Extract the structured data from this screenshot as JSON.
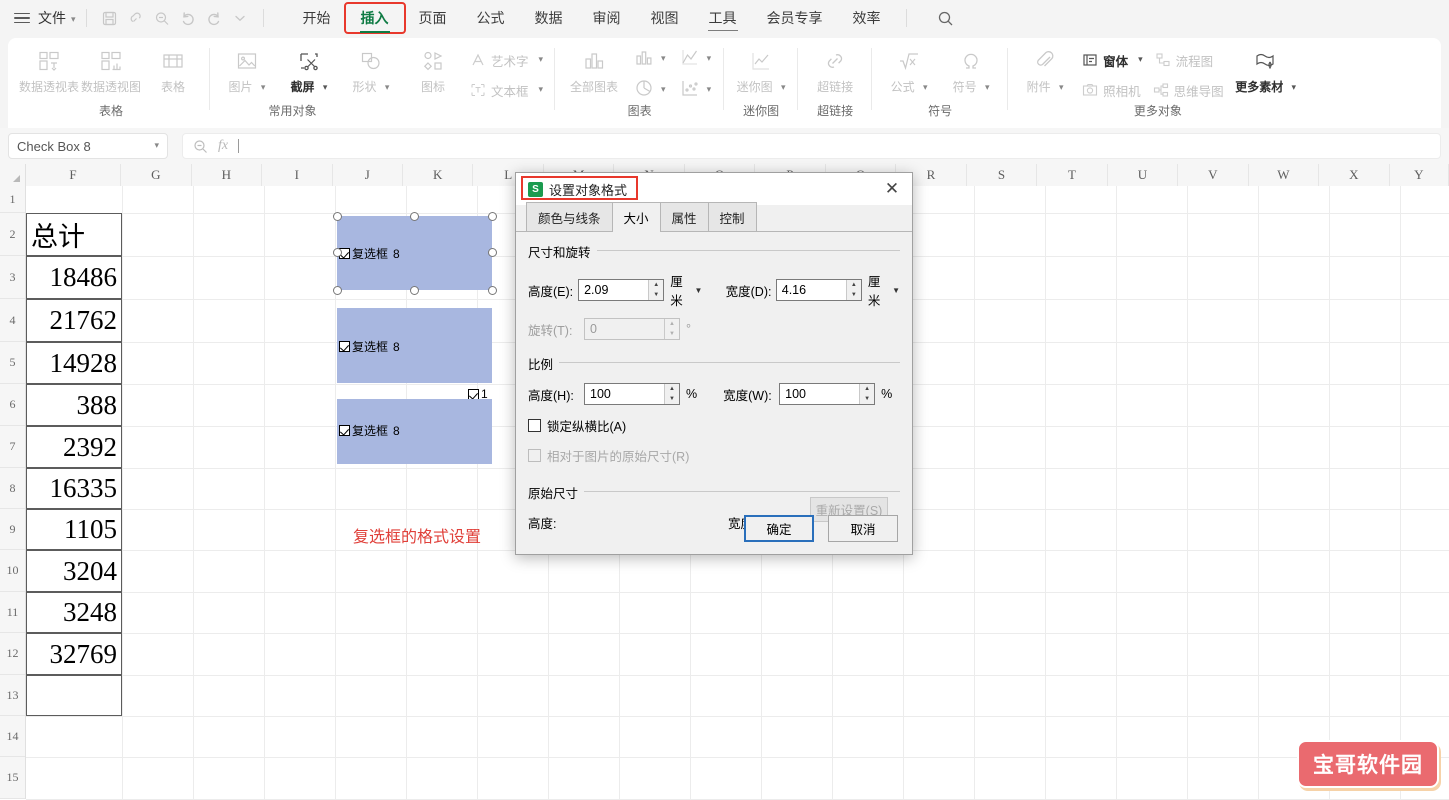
{
  "menubar": {
    "file_label": "文件",
    "quick_icons": [
      "save-icon",
      "link-icon",
      "find-replace-icon",
      "undo-icon",
      "redo-icon",
      "more-icon"
    ],
    "tabs": [
      {
        "label": "开始",
        "state": "normal"
      },
      {
        "label": "插入",
        "state": "active"
      },
      {
        "label": "页面",
        "state": "normal"
      },
      {
        "label": "公式",
        "state": "normal"
      },
      {
        "label": "数据",
        "state": "normal"
      },
      {
        "label": "审阅",
        "state": "normal"
      },
      {
        "label": "视图",
        "state": "normal"
      },
      {
        "label": "工具",
        "state": "underlined"
      },
      {
        "label": "会员专享",
        "state": "normal"
      },
      {
        "label": "效率",
        "state": "normal"
      }
    ],
    "search_icon": "search-icon"
  },
  "ribbon": {
    "groups": [
      {
        "label": "表格",
        "items": [
          {
            "label": "数据透视表",
            "icon": "pivot-table-icon",
            "enabled": false,
            "dropdown": false
          },
          {
            "label": "数据透视图",
            "icon": "pivot-chart-icon",
            "enabled": false,
            "dropdown": false
          },
          {
            "label": "表格",
            "icon": "table-icon",
            "enabled": false,
            "dropdown": false
          }
        ]
      },
      {
        "label": "常用对象",
        "items": [
          {
            "label": "图片",
            "icon": "picture-icon",
            "enabled": false,
            "dropdown": true
          },
          {
            "label": "截屏",
            "icon": "screenshot-icon",
            "enabled": true,
            "dropdown": true
          },
          {
            "label": "形状",
            "icon": "shapes-icon",
            "enabled": false,
            "dropdown": true
          },
          {
            "label": "图标",
            "icon": "icons-icon",
            "enabled": false,
            "dropdown": false
          }
        ],
        "rows": [
          {
            "label": "艺术字",
            "icon": "wordart-icon",
            "enabled": false,
            "dropdown": true
          },
          {
            "label": "文本框",
            "icon": "textbox-icon",
            "enabled": false,
            "dropdown": true
          }
        ]
      },
      {
        "label": "图表",
        "items": [
          {
            "label": "全部图表",
            "icon": "all-charts-icon",
            "enabled": false,
            "dropdown": false
          }
        ],
        "mini": [
          {
            "icon": "bar-chart-icon",
            "dropdown": true
          },
          {
            "icon": "pie-chart-icon",
            "dropdown": true
          },
          {
            "icon": "line-chart-icon",
            "dropdown": true
          },
          {
            "icon": "scatter-chart-icon",
            "dropdown": true
          }
        ]
      },
      {
        "label": "迷你图",
        "items": [
          {
            "label": "迷你图",
            "icon": "sparkline-icon",
            "enabled": false,
            "dropdown": true
          }
        ]
      },
      {
        "label": "超链接",
        "items": [
          {
            "label": "超链接",
            "icon": "hyperlink-icon",
            "enabled": false,
            "dropdown": false
          }
        ]
      },
      {
        "label": "符号",
        "items": [
          {
            "label": "公式",
            "icon": "formula-icon",
            "enabled": false,
            "dropdown": true
          },
          {
            "label": "符号",
            "icon": "symbol-icon",
            "enabled": false,
            "dropdown": true
          }
        ]
      },
      {
        "label": "更多对象",
        "items": [
          {
            "label": "附件",
            "icon": "attachment-icon",
            "enabled": false,
            "dropdown": true
          }
        ],
        "rows2": [
          {
            "label": "窗体",
            "icon": "form-icon",
            "enabled": true,
            "dropdown": true
          },
          {
            "label": "照相机",
            "icon": "camera-icon",
            "enabled": false,
            "dropdown": false
          },
          {
            "label": "流程图",
            "icon": "flowchart-icon",
            "enabled": false,
            "dropdown": false
          },
          {
            "label": "思维导图",
            "icon": "mindmap-icon",
            "enabled": false,
            "dropdown": false
          }
        ],
        "last": {
          "label": "更多素材",
          "icon": "more-materials-icon",
          "enabled": true,
          "dropdown": true
        }
      }
    ]
  },
  "formula_bar": {
    "name_box_value": "Check Box 8",
    "name_box_caret": "chevron-down-icon",
    "insert_function_icon": "insert-function-icon",
    "fx_icon": "fx-icon",
    "formula_value": ""
  },
  "sheet": {
    "columns": [
      "F",
      "G",
      "H",
      "I",
      "J",
      "K",
      "L",
      "M",
      "N",
      "O",
      "P",
      "Q",
      "R",
      "S",
      "T",
      "U",
      "V",
      "W",
      "X",
      "Y"
    ],
    "rows": [
      "1",
      "2",
      "3",
      "4",
      "5",
      "6",
      "7",
      "8",
      "9",
      "10",
      "11",
      "12",
      "13",
      "14",
      "15"
    ],
    "column_f_values": [
      {
        "row": "2",
        "value": "总计"
      },
      {
        "row": "3",
        "value": "18486"
      },
      {
        "row": "4",
        "value": "21762"
      },
      {
        "row": "5",
        "value": "14928"
      },
      {
        "row": "6",
        "value": "388"
      },
      {
        "row": "7",
        "value": "2392"
      },
      {
        "row": "8",
        "value": "16335"
      },
      {
        "row": "9",
        "value": "1105"
      },
      {
        "row": "10",
        "value": "3204"
      },
      {
        "row": "11",
        "value": "3248"
      },
      {
        "row": "12",
        "value": "32769"
      },
      {
        "row": "13",
        "value": ""
      }
    ],
    "checkbox_objects": [
      {
        "label": "复选框",
        "number": "8",
        "selected": true
      },
      {
        "label": "复选框",
        "number": "8",
        "selected": false
      },
      {
        "label": "复选框",
        "number": "8",
        "selected": false
      }
    ],
    "small_checkbox_label": "1",
    "red_annotation": "复选框的格式设置"
  },
  "dialog": {
    "app_badge": "S",
    "title": "设置对象格式",
    "close_icon": "close-icon",
    "tabs": [
      {
        "label": "颜色与线条",
        "active": false
      },
      {
        "label": "大小",
        "active": true
      },
      {
        "label": "属性",
        "active": false
      },
      {
        "label": "控制",
        "active": false
      }
    ],
    "size_section": {
      "legend": "尺寸和旋转",
      "height_label": "高度(E):",
      "height_value": "2.09",
      "height_unit": "厘米",
      "width_label": "宽度(D):",
      "width_value": "4.16",
      "width_unit": "厘米",
      "rotate_label": "旋转(T):",
      "rotate_value": "0",
      "rotate_unit": "°"
    },
    "scale_section": {
      "legend": "比例",
      "height_label": "高度(H):",
      "height_value": "100",
      "height_unit": "%",
      "width_label": "宽度(W):",
      "width_value": "100",
      "width_unit": "%",
      "lock_ratio_label": "锁定纵横比(A)",
      "lock_ratio_checked": false,
      "relative_label": "相对于图片的原始尺寸(R)",
      "relative_checked": false
    },
    "original_section": {
      "legend": "原始尺寸",
      "height_label": "高度:",
      "height_value": "",
      "width_label": "宽度:",
      "width_value": "",
      "reset_button": "重新设置(S)"
    },
    "footer": {
      "ok_label": "确定",
      "cancel_label": "取消"
    }
  },
  "watermark": {
    "text": "宝哥软件园"
  },
  "colors": {
    "accent_green": "#0f7b44",
    "highlight_red": "#e8382c",
    "shape_blue": "#a8b7e0",
    "dialog_bg": "#f0f0f0",
    "watermark_bg": "#ea6a6f"
  }
}
